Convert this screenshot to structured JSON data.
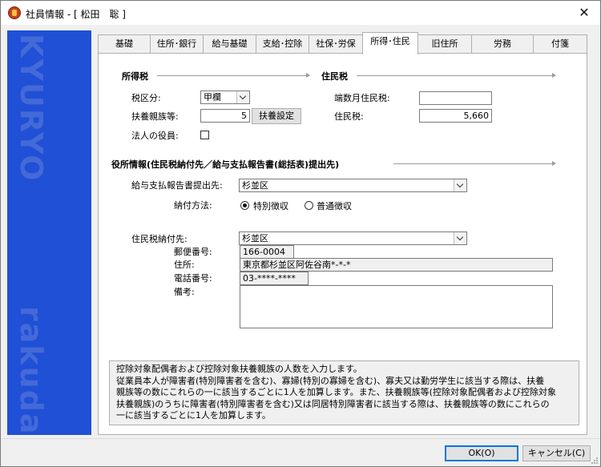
{
  "window": {
    "title": "社員情報 - [ 松田　聡 ]",
    "close_glyph": "✕"
  },
  "sidebar": {
    "brand_top": "KYURYO",
    "brand_bottom": "rakuda"
  },
  "tabs": [
    {
      "label": "基礎"
    },
    {
      "label": "住所･銀行"
    },
    {
      "label": "給与基礎"
    },
    {
      "label": "支給･控除"
    },
    {
      "label": "社保･労保"
    },
    {
      "label": "所得･住民"
    },
    {
      "label": "旧住所"
    },
    {
      "label": "労務"
    },
    {
      "label": "付箋"
    }
  ],
  "active_tab": "所得･住民",
  "income_tax": {
    "heading": "所得税",
    "tax_class_label": "税区分:",
    "tax_class_value": "甲欄",
    "dependents_label": "扶養親族等:",
    "dependents_value": "5",
    "dependents_button": "扶養設定",
    "officer_label": "法人の役員:"
  },
  "resident_tax": {
    "heading": "住民税",
    "fraction_label": "端数月住民税:",
    "fraction_value": "",
    "tax_label": "住民税:",
    "tax_value": "5,660"
  },
  "office_info": {
    "heading": "役所情報(住民税納付先／給与支払報告書(総括表)提出先)",
    "report_dest_label": "給与支払報告書提出先:",
    "report_dest_value": "杉並区",
    "payment_method_label": "納付方法:",
    "payment_special": "特別徴収",
    "payment_normal": "普通徴収",
    "payee_label": "住民税納付先:",
    "payee_value": "杉並区",
    "postal_label": "郵便番号:",
    "postal_value": "166-0004",
    "address_label": "住所:",
    "address_value": "東京都杉並区阿佐谷南*-*-*",
    "phone_label": "電話番号:",
    "phone_value": "03-****-****",
    "remarks_label": "備考:"
  },
  "help_text": [
    "控除対象配偶者および控除対象扶養親族の人数を入力します。",
    "従業員本人が障害者(特別障害者を含む)、寡婦(特別の寡婦を含む)、寡夫又は勤労学生に該当する際は、扶養",
    "親族等の数にこれらの一に該当するごとに1人を加算します。また、扶養親族等(控除対象配偶者および控除対象",
    "扶養親族)のうちに障害者(特別障害者を含む)又は同居特別障害者に該当する際は、扶養親族等の数にこれらの",
    "一に該当するごとに1人を加算します。"
  ],
  "footer": {
    "ok_label": "OK(O)",
    "cancel_label": "キャンセル(C)"
  }
}
